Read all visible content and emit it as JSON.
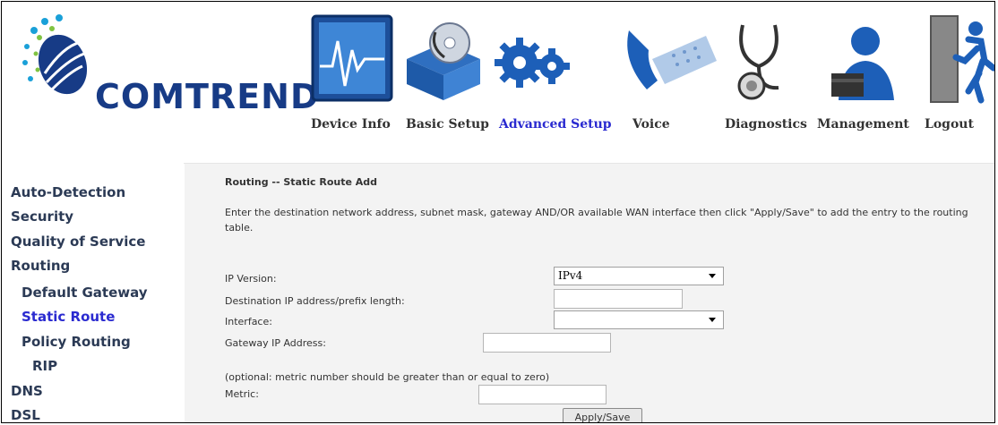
{
  "header": {
    "logo_text": "COMTREND",
    "nav": [
      {
        "label": "Device Info",
        "icon": "device-info-chart-icon"
      },
      {
        "label": "Basic Setup",
        "icon": "cd-box-icon"
      },
      {
        "label": "Advanced Setup",
        "icon": "gears-icon",
        "active": true
      },
      {
        "label": "Voice",
        "icon": "phone-icon"
      },
      {
        "label": "Diagnostics",
        "icon": "stethoscope-icon"
      },
      {
        "label": "Management",
        "icon": "user-laptop-icon"
      },
      {
        "label": "Logout",
        "icon": "exit-door-icon"
      }
    ]
  },
  "sidebar": {
    "items": [
      {
        "label": "Auto-Detection"
      },
      {
        "label": "Security"
      },
      {
        "label": "Quality of Service"
      },
      {
        "label": "Routing"
      },
      {
        "label": "Default Gateway"
      },
      {
        "label": "Static Route",
        "active": true
      },
      {
        "label": "Policy Routing"
      },
      {
        "label": "RIP"
      },
      {
        "label": "DNS"
      },
      {
        "label": "DSL"
      }
    ]
  },
  "main": {
    "title": "Routing -- Static Route Add",
    "description": "Enter the destination network address, subnet mask, gateway AND/OR available WAN interface then click \"Apply/Save\" to add the entry to the routing table.",
    "ip_version_label": "IP Version:",
    "ip_version_value": "IPv4",
    "dest_label": "Destination IP address/prefix length:",
    "dest_value": "",
    "interface_label": "Interface:",
    "interface_value": "",
    "gateway_label": "Gateway IP Address:",
    "gateway_value": "",
    "metric_note": "(optional: metric number should be greater than or equal to zero)",
    "metric_label": "Metric:",
    "metric_value": "",
    "apply_label": "Apply/Save"
  },
  "colors": {
    "brand": "#173b86",
    "active_link": "#2a2ad0",
    "content_bg": "#f3f3f3"
  }
}
